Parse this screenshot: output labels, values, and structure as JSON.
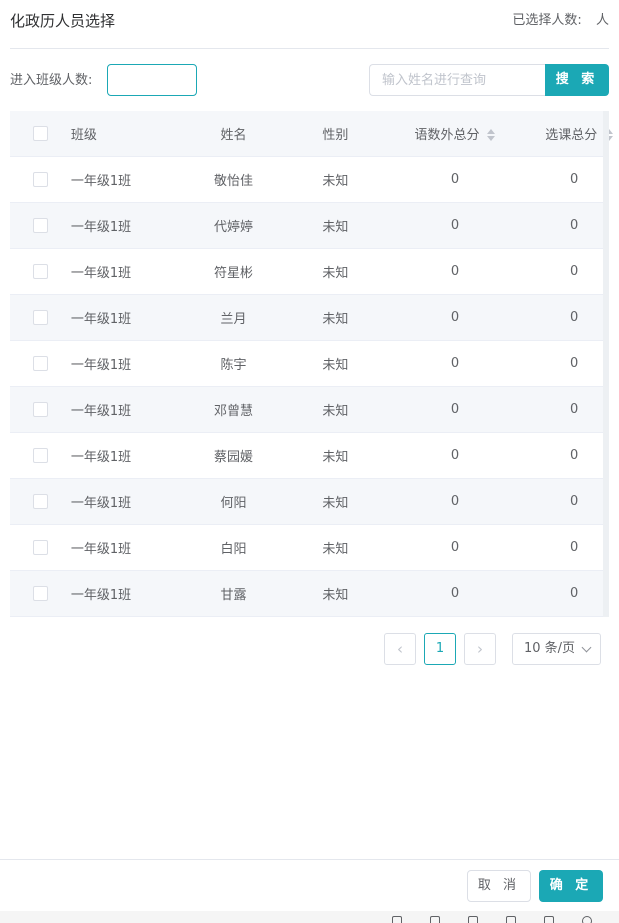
{
  "header": {
    "title": "化政历人员选择",
    "selected_label": "已选择人数:",
    "selected_count": "",
    "selected_unit": "人"
  },
  "filters": {
    "class_count_label": "进入班级人数:",
    "class_count_value": "",
    "search_placeholder": "输入姓名进行查询",
    "search_button": "搜 索"
  },
  "table": {
    "columns": [
      "班级",
      "姓名",
      "性别",
      "语数外总分",
      "选课总分"
    ],
    "rows": [
      {
        "class": "一年级1班",
        "name": "敬怡佳",
        "gender": "未知",
        "main_total": "0",
        "elective_total": "0"
      },
      {
        "class": "一年级1班",
        "name": "代婷婷",
        "gender": "未知",
        "main_total": "0",
        "elective_total": "0"
      },
      {
        "class": "一年级1班",
        "name": "符星彬",
        "gender": "未知",
        "main_total": "0",
        "elective_total": "0"
      },
      {
        "class": "一年级1班",
        "name": "兰月",
        "gender": "未知",
        "main_total": "0",
        "elective_total": "0"
      },
      {
        "class": "一年级1班",
        "name": "陈宇",
        "gender": "未知",
        "main_total": "0",
        "elective_total": "0"
      },
      {
        "class": "一年级1班",
        "name": "邓曾慧",
        "gender": "未知",
        "main_total": "0",
        "elective_total": "0"
      },
      {
        "class": "一年级1班",
        "name": "蔡园媛",
        "gender": "未知",
        "main_total": "0",
        "elective_total": "0"
      },
      {
        "class": "一年级1班",
        "name": "何阳",
        "gender": "未知",
        "main_total": "0",
        "elective_total": "0"
      },
      {
        "class": "一年级1班",
        "name": "白阳",
        "gender": "未知",
        "main_total": "0",
        "elective_total": "0"
      },
      {
        "class": "一年级1班",
        "name": "甘露",
        "gender": "未知",
        "main_total": "0",
        "elective_total": "0"
      }
    ]
  },
  "pagination": {
    "prev_icon": "chevron-left-icon",
    "next_icon": "chevron-right-icon",
    "prev_glyph": "‹",
    "next_glyph": "›",
    "current_page": "1",
    "page_size": "10 条/页"
  },
  "footer": {
    "cancel_label": "取 消",
    "confirm_label": "确 定"
  },
  "colors": {
    "accent": "#1ba8b5",
    "text": "#606266",
    "border": "#dcdfe6",
    "stripe": "#f5f7fa"
  }
}
